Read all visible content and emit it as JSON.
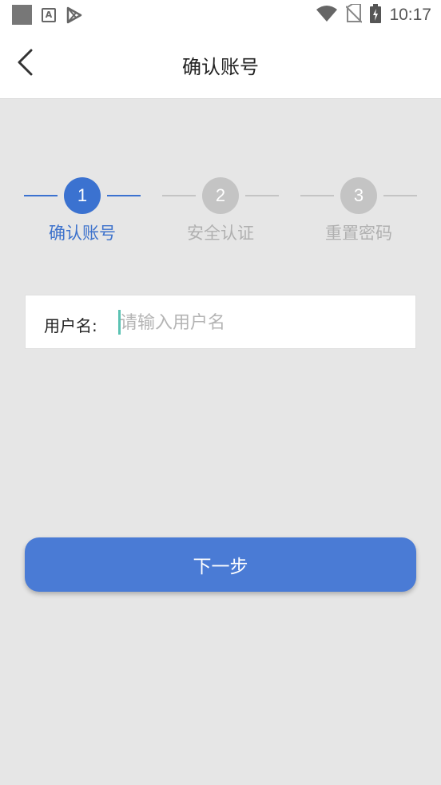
{
  "status_bar": {
    "time": "10:17",
    "left_icons": [
      "square-icon",
      "a-icon",
      "play-store-icon"
    ],
    "right_icons": [
      "wifi-icon",
      "no-sim-icon",
      "battery-charging-icon"
    ]
  },
  "header": {
    "title": "确认账号",
    "back_icon": "chevron-left-icon"
  },
  "steps": [
    {
      "number": "1",
      "label": "确认账号",
      "state": "active"
    },
    {
      "number": "2",
      "label": "安全认证",
      "state": "inactive"
    },
    {
      "number": "3",
      "label": "重置密码",
      "state": "inactive"
    }
  ],
  "colors": {
    "accent": "#3b72d0",
    "inactive": "#c4c4c4",
    "button": "#4a7bd5",
    "background": "#e6e6e6"
  },
  "form": {
    "username_label": "用户名:",
    "username_value": "",
    "username_placeholder": "请输入用户名"
  },
  "actions": {
    "next_label": "下一步"
  }
}
